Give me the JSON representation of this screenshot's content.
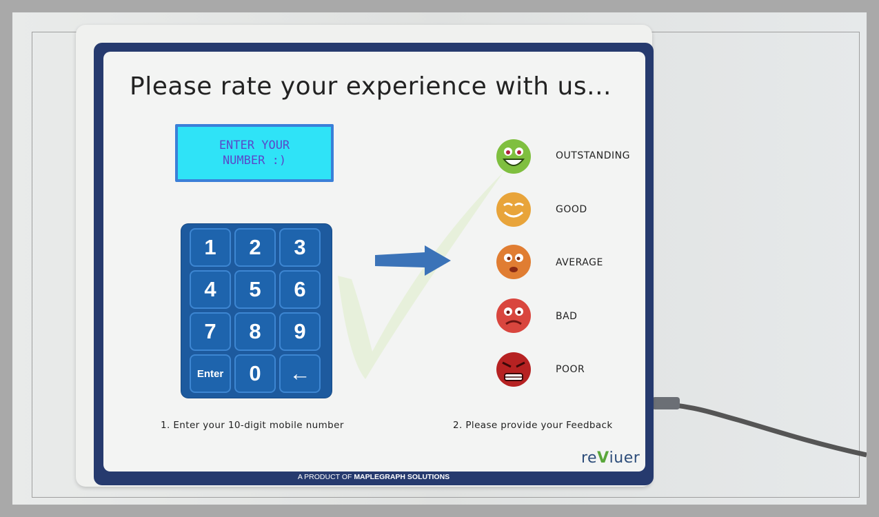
{
  "title": "Please rate your experience with us...",
  "lcd": {
    "line1": "ENTER YOUR",
    "line2": "NUMBER  :)"
  },
  "keypad": {
    "keys": [
      "1",
      "2",
      "3",
      "4",
      "5",
      "6",
      "7",
      "8",
      "9",
      "Enter",
      "0",
      "←"
    ]
  },
  "feedback": {
    "options": [
      {
        "label": "OUTSTANDING",
        "color": "#7fbf3f"
      },
      {
        "label": "GOOD",
        "color": "#e8a43a"
      },
      {
        "label": "AVERAGE",
        "color": "#e07d32"
      },
      {
        "label": "BAD",
        "color": "#d9463e"
      },
      {
        "label": "POOR",
        "color": "#b62222"
      }
    ]
  },
  "steps": {
    "step1": "1. Enter your 10-digit mobile number",
    "step2": "2. Please provide your Feedback"
  },
  "brand": {
    "prefix": "re",
    "v": "V",
    "suffix": "iuer"
  },
  "footer": {
    "prefix": "A PRODUCT OF ",
    "company": "MAPLEGRAPH SOLUTIONS"
  },
  "colors": {
    "panel_border": "#263a6e",
    "keypad": "#1d5a9e",
    "lcd": "#2fe3f7",
    "arrow": "#3b73b8"
  }
}
